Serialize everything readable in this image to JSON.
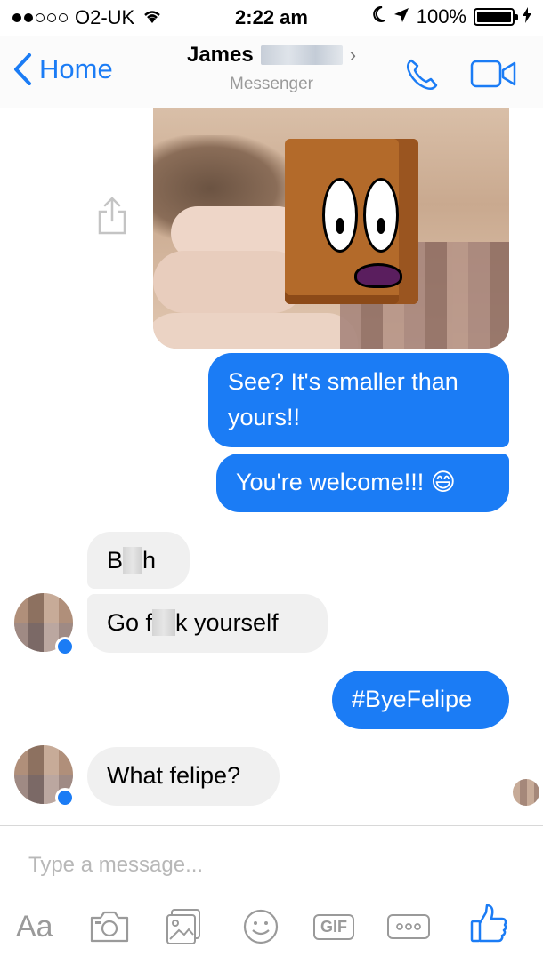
{
  "status_bar": {
    "carrier": "O2-UK",
    "time": "2:22 am",
    "battery": "100%"
  },
  "nav": {
    "back_label": "Home",
    "contact_name": "James",
    "subtitle": "Messenger"
  },
  "messages": [
    {
      "from": "me",
      "type": "photo"
    },
    {
      "from": "me",
      "text": "See? It's smaller than yours!!"
    },
    {
      "from": "me",
      "text": "You're welcome!!!",
      "emoji": "😄"
    },
    {
      "from": "them",
      "text_start": "B",
      "text_end": "h"
    },
    {
      "from": "them",
      "text_start": "Go f",
      "text_end": "k yourself"
    },
    {
      "from": "me",
      "text": "#ByeFelipe"
    },
    {
      "from": "them",
      "text": "What felipe?"
    }
  ],
  "composer": {
    "placeholder": "Type a message...",
    "aa_label": "Aa",
    "gif_label": "GIF"
  },
  "colors": {
    "accent": "#1b7cf5",
    "incoming_bubble": "#f0f0f0"
  },
  "icons": [
    "wifi-icon",
    "moon-icon",
    "location-arrow-icon",
    "battery-icon",
    "charging-bolt-icon",
    "back-chevron-icon",
    "phone-icon",
    "video-camera-icon",
    "share-icon",
    "camera-icon",
    "gallery-icon",
    "emoji-icon",
    "more-icon",
    "thumbs-up-icon"
  ]
}
